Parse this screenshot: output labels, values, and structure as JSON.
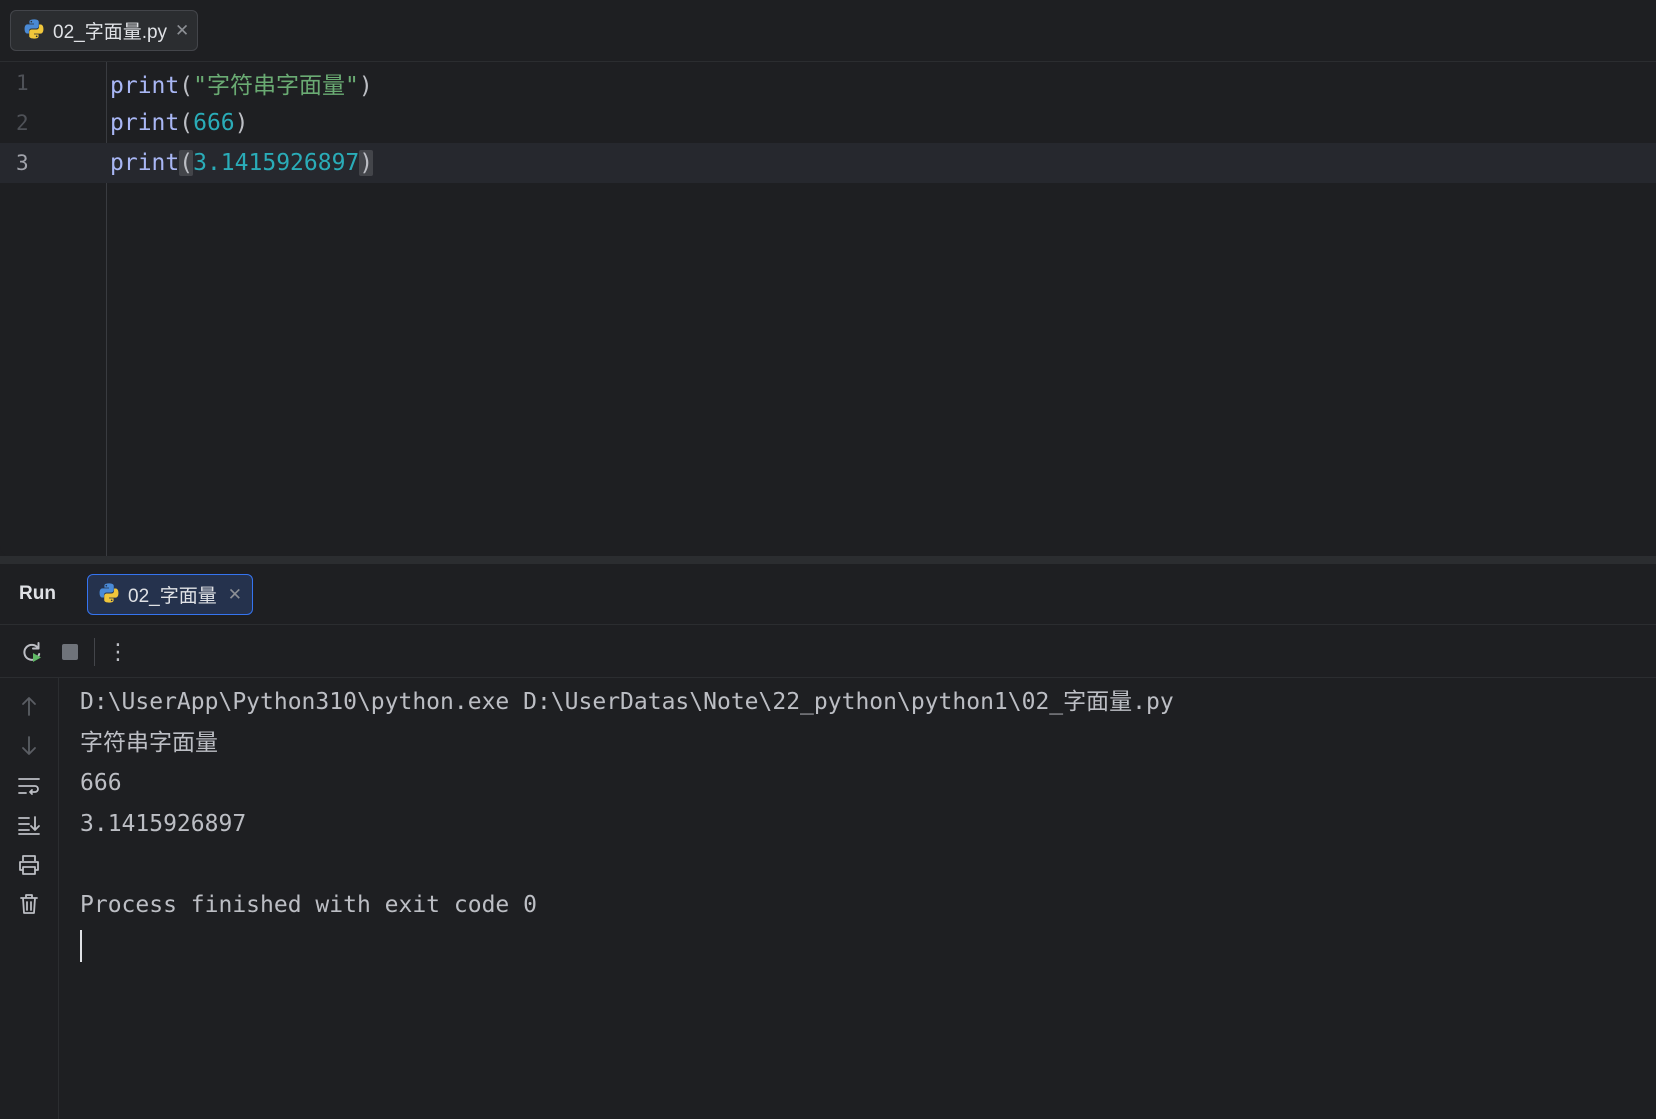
{
  "editor": {
    "tab": {
      "label": "02_字面量.py",
      "icon": "python-icon",
      "close": "✕"
    },
    "lines": [
      {
        "number": "1",
        "func": "print",
        "open": "(",
        "arg": "\"字符串字面量\"",
        "arg_type": "string",
        "close": ")"
      },
      {
        "number": "2",
        "func": "print",
        "open": "(",
        "arg": "666",
        "arg_type": "number",
        "close": ")"
      },
      {
        "number": "3",
        "func": "print",
        "open": "(",
        "arg": "3.1415926897",
        "arg_type": "number",
        "close": ")"
      }
    ],
    "current_line": 3
  },
  "run_panel": {
    "title": "Run",
    "tab": {
      "label": "02_字面量",
      "icon": "python-icon",
      "close": "✕"
    },
    "toolbar": {
      "more": "⋮",
      "icons": [
        "rerun-icon",
        "stop-icon",
        "more-options-icon"
      ]
    },
    "side_icons": [
      "scroll-up-icon",
      "scroll-down-icon",
      "soft-wrap-icon",
      "scroll-to-end-icon",
      "print-icon",
      "clear-icon"
    ],
    "console": [
      "D:\\UserApp\\Python310\\python.exe D:\\UserDatas\\Note\\22_python\\python1\\02_字面量.py",
      "字符串字面量",
      "666",
      "3.1415926897",
      "",
      "Process finished with exit code 0"
    ]
  },
  "colors": {
    "background": "#1e1f22",
    "function": "#a9b7f5",
    "string": "#6aab73",
    "number": "#2aacb8",
    "accent": "#3574f0"
  }
}
